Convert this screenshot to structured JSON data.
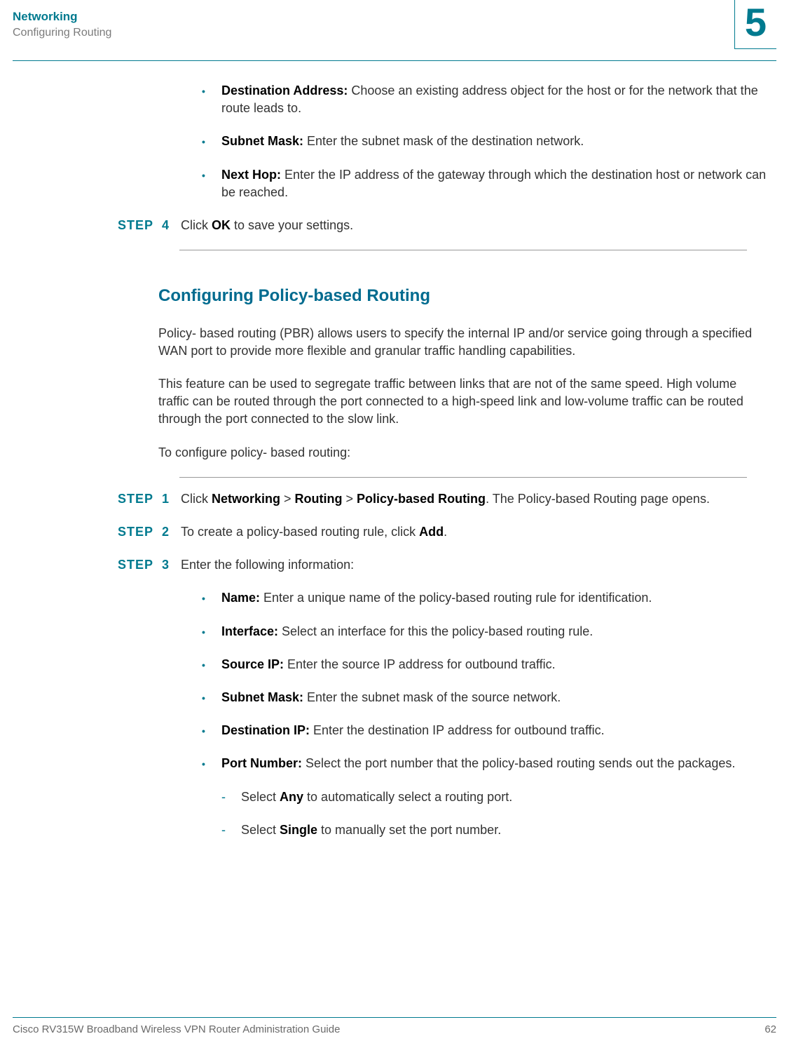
{
  "header": {
    "title": "Networking",
    "subtitle": "Configuring Routing",
    "chapter": "5"
  },
  "top_bullets": [
    {
      "bold": "Destination Address:",
      "text": " Choose an existing address object for the host or for the network that the route leads to."
    },
    {
      "bold": "Subnet Mask:",
      "text": " Enter the subnet mask of the destination network."
    },
    {
      "bold": "Next Hop:",
      "text": " Enter the IP address of the gateway through which the destination host or network can be reached."
    }
  ],
  "step4": {
    "label": "STEP",
    "num": "4",
    "pre": "Click ",
    "bold": "OK",
    "post": " to save your settings."
  },
  "section_title": "Configuring Policy-based Routing",
  "para1": "Policy- based routing (PBR) allows users to specify the internal IP and/or service going through a specified WAN port to provide more flexible and granular traffic handling capabilities.",
  "para2": "This feature can be used to segregate traffic between links that are not of the same speed. High volume traffic can be routed through the port connected to a high-speed link and low-volume traffic can be routed through the port connected to the slow link.",
  "para3": "To configure policy- based routing:",
  "steps": [
    {
      "label": "STEP",
      "num": "1",
      "parts": [
        "Click ",
        "Networking",
        " > ",
        "Routing",
        " > ",
        "Policy-based Routing",
        ". The Policy-based Routing page opens."
      ]
    },
    {
      "label": "STEP",
      "num": "2",
      "parts": [
        "To create a policy-based routing rule, click ",
        "Add",
        "."
      ]
    },
    {
      "label": "STEP",
      "num": "3",
      "parts": [
        "Enter the following information:"
      ]
    }
  ],
  "pbr_bullets": [
    {
      "bold": "Name:",
      "text": " Enter a unique name of the policy-based routing rule for identification."
    },
    {
      "bold": "Interface:",
      "text": " Select an interface for this the policy-based routing rule."
    },
    {
      "bold": "Source IP:",
      "text": " Enter the source IP address for outbound traffic."
    },
    {
      "bold": "Subnet Mask:",
      "text": " Enter the subnet mask of the source network."
    },
    {
      "bold": "Destination IP:",
      "text": " Enter the destination IP address for outbound traffic."
    },
    {
      "bold": "Port Number:",
      "text": " Select the port number that the policy-based routing sends out the packages."
    }
  ],
  "sub_items": [
    {
      "pre": "Select ",
      "bold": "Any",
      "post": " to automatically select a routing port."
    },
    {
      "pre": "Select ",
      "bold": "Single",
      "post": " to manually set the port number."
    }
  ],
  "footer": {
    "left": "Cisco RV315W Broadband Wireless VPN Router Administration Guide",
    "right": "62"
  }
}
